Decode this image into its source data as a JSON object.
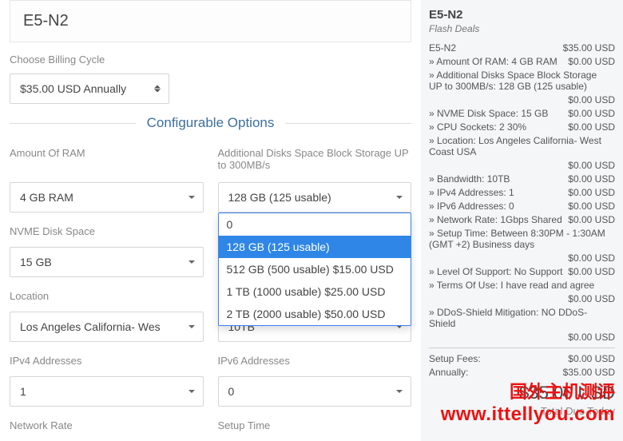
{
  "product": {
    "title": "E5-N2"
  },
  "billing": {
    "label": "Choose Billing Cycle",
    "value": "$35.00 USD Annually"
  },
  "config_title": "Configurable Options",
  "fields": {
    "ram": {
      "label": "Amount Of RAM",
      "value": "4 GB RAM"
    },
    "disks": {
      "label": "Additional Disks Space Block Storage UP to 300MB/s",
      "value": "128 GB (125 usable)",
      "options": [
        "0",
        "128 GB (125 usable)",
        "512 GB (500 usable) $15.00 USD",
        "1 TB (1000 usable) $25.00 USD",
        "2 TB (2000 usable) $50.00 USD"
      ]
    },
    "nvme": {
      "label": "NVME Disk Space",
      "value": "15 GB"
    },
    "location": {
      "label": "Location",
      "value": "Los Angeles California- Wes"
    },
    "bandwidth": {
      "label": "",
      "value": "10TB"
    },
    "ipv4": {
      "label": "IPv4 Addresses",
      "value": "1"
    },
    "ipv6": {
      "label": "IPv6 Addresses",
      "value": "0"
    },
    "network": {
      "label": "Network Rate"
    },
    "setup": {
      "label": "Setup Time"
    }
  },
  "summary": {
    "title": "E5-N2",
    "subtitle": "Flash Deals",
    "lines": [
      {
        "l": "E5-N2",
        "r": "$35.00 USD"
      },
      {
        "l": "» Amount Of RAM: 4 GB RAM",
        "r": "$0.00 USD"
      },
      {
        "l": "» Additional Disks Space Block Storage UP to 300MB/s: 128 GB (125 usable)",
        "r": ""
      },
      {
        "l": "",
        "r": "$0.00 USD"
      },
      {
        "l": "» NVME Disk Space: 15 GB",
        "r": "$0.00 USD"
      },
      {
        "l": "» CPU Sockets: 2 30%",
        "r": "$0.00 USD"
      },
      {
        "l": "» Location: Los Angeles California- West Coast USA",
        "r": ""
      },
      {
        "l": "",
        "r": "$0.00 USD"
      },
      {
        "l": "» Bandwidth: 10TB",
        "r": "$0.00 USD"
      },
      {
        "l": "» IPv4 Addresses: 1",
        "r": "$0.00 USD"
      },
      {
        "l": "» IPv6 Addresses: 0",
        "r": "$0.00 USD"
      },
      {
        "l": "» Network Rate: 1Gbps Shared",
        "r": "$0.00 USD"
      },
      {
        "l": "» Setup Time: Between 8:30PM - 1:30AM (GMT +2) Business days",
        "r": ""
      },
      {
        "l": "",
        "r": "$0.00 USD"
      },
      {
        "l": "» Level Of Support: No Support",
        "r": "$0.00 USD"
      },
      {
        "l": "» Terms Of Use: I have read and agree",
        "r": ""
      },
      {
        "l": "",
        "r": "$0.00 USD"
      },
      {
        "l": "» DDoS-Shield Mitigation: NO DDoS-Shield",
        "r": ""
      },
      {
        "l": "",
        "r": "$0.00 USD"
      }
    ],
    "fees": [
      {
        "l": "Setup Fees:",
        "r": "$0.00 USD"
      },
      {
        "l": "Annually:",
        "r": "$35.00 USD"
      }
    ],
    "total": "$35.00 USD",
    "total_label": "Total Due Today"
  },
  "watermark": {
    "line1": "国外主机测评",
    "line2": "www.ittellyou.com"
  }
}
